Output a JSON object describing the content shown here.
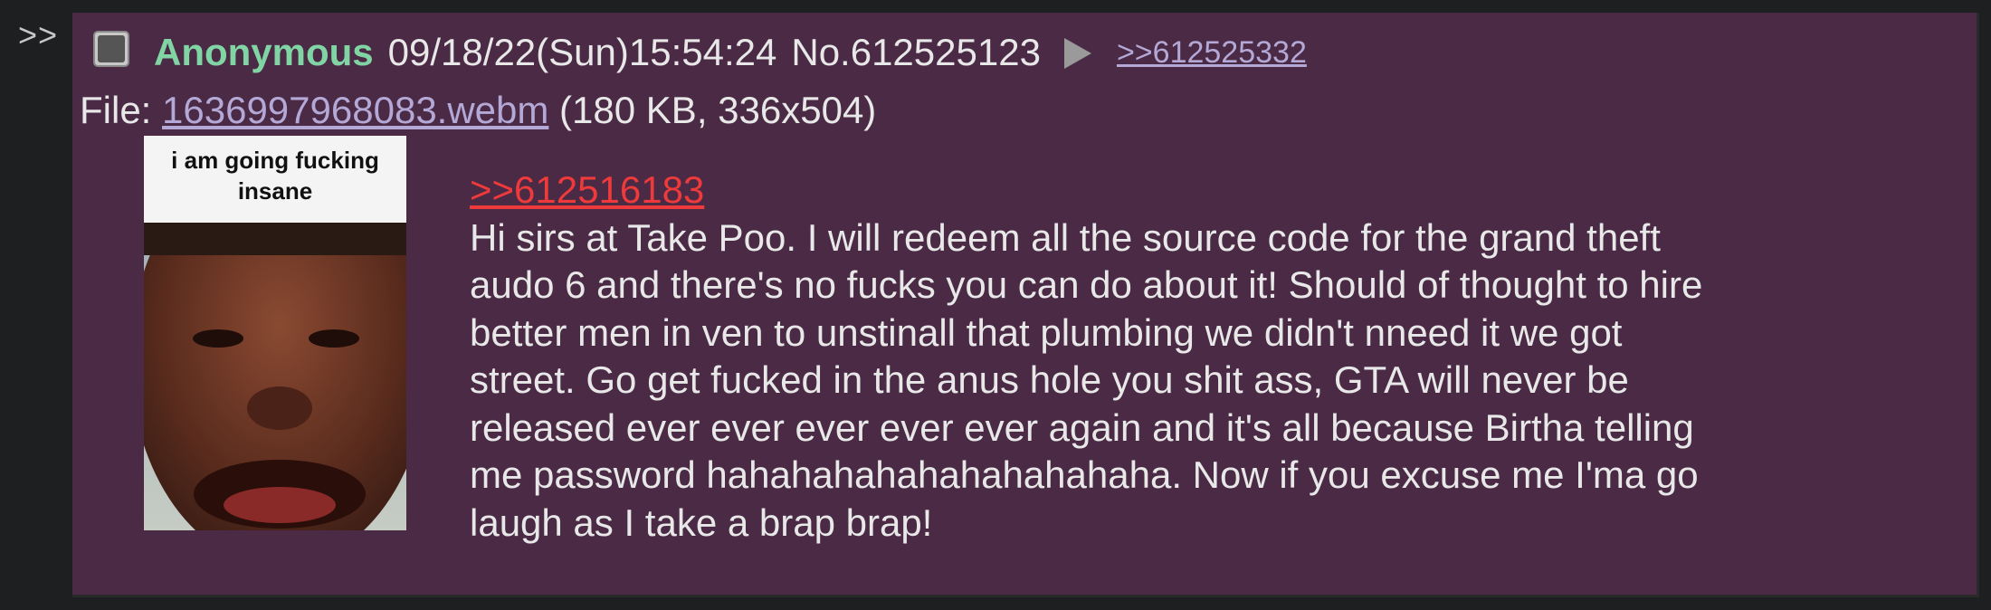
{
  "side_marker": ">>",
  "post": {
    "name": "Anonymous",
    "datetime": "09/18/22(Sun)15:54:24",
    "post_number": "No.612525123",
    "reply_backlink": ">>612525332",
    "file": {
      "label": "File: ",
      "filename": "1636997968083.webm",
      "info": " (180 KB, 336x504)"
    },
    "thumbnail": {
      "caption_line1": "i am going fucking",
      "caption_line2": "insane"
    },
    "quote_link": ">>612516183",
    "body_lines": [
      "Hi sirs at Take Poo. I will redeem all the source code for the grand theft",
      "audo 6 and there's no fucks you can do about it! Should of thought to hire",
      "better men in ven to unstinall that plumbing we didn't nneed it we got",
      "street. Go get fucked in the anus hole you shit ass, GTA will never be",
      "released ever ever ever ever ever again and it's all because Birtha telling",
      "me password hahahahahahahahahahaha. Now if you excuse me I'ma go",
      "laugh as I take a brap brap!"
    ]
  },
  "colors": {
    "post_background": "#4a2a44",
    "name": "#81d4a4",
    "link": "#b3a8d6",
    "quote_link": "#ee3a3a"
  }
}
